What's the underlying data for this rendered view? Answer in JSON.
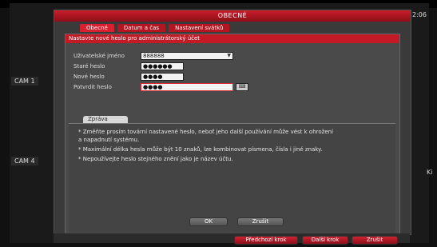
{
  "window": {
    "title": "OBECNÉ"
  },
  "tabs": [
    "Obecné",
    "Datum a čas",
    "Nastavení svátků"
  ],
  "header": {
    "text": "Nastavte nové heslo pro administrátorský účet"
  },
  "form": {
    "username": {
      "label": "Uživatelské jméno",
      "value": "888888"
    },
    "old_password": {
      "label": "Staré heslo",
      "value": "●●●●●●"
    },
    "new_password": {
      "label": "Nové heslo",
      "value": "●●●●"
    },
    "confirm_password": {
      "label": "Potvrdit heslo",
      "value": "●●●●"
    }
  },
  "message": {
    "tab_label": "Zpráva",
    "lines": [
      "* Změňte prosím tovární nastavené heslo, neboť jeho další používání může vést k ohrožení",
      "a napadnutí systému.",
      "* Maximální délka hesla může být 10 znaků, lze kombinovat písmena, čísla i jiné znaky.",
      "* Nepoužívejte heslo stejného znění jako je název účtu."
    ]
  },
  "buttons": {
    "ok": "OK",
    "cancel": "Zrušit",
    "prev": "Předchozí krok",
    "next": "Další krok",
    "cancel2": "Zrušit"
  },
  "background": {
    "cam1": "CAM 1",
    "cam4": "CAM 4",
    "time": "2:06",
    "right_edge": "Ki"
  }
}
